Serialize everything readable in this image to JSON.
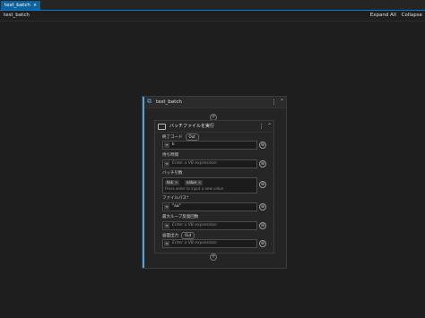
{
  "tabs": [
    {
      "label": "test_batch",
      "close": "×"
    }
  ],
  "header": {
    "title": "test_batch",
    "expand_all": "Expand All",
    "collapse": "Collapse"
  },
  "sequence": {
    "title": "test_batch",
    "more": "⋮",
    "collapse": "⌃"
  },
  "activity": {
    "title": "バッチファイルを実行",
    "more": "⋮",
    "collapse": "⌃",
    "fields": {
      "exit_code": {
        "label": "終了コード",
        "badge": "Out",
        "value": "k"
      },
      "wait_time": {
        "label": "待ち時間",
        "placeholder": "Enter a VB expression"
      },
      "batch_args": {
        "label": "バッチ引数",
        "chips": [
          "kkk",
          "value"
        ],
        "hint": "Press enter to input a new value"
      },
      "file_path": {
        "label": "ファイルパス",
        "required": "*",
        "value": "\"aa\""
      },
      "max_loop": {
        "label": "最大ループ反復回数",
        "placeholder": "Enter a VB expression"
      },
      "screen_output": {
        "label": "画面出力",
        "badge": "Out",
        "placeholder": "Enter a VB expression"
      }
    }
  },
  "icons": {
    "vb": "≡",
    "plus": "+",
    "gear": "⊕"
  }
}
